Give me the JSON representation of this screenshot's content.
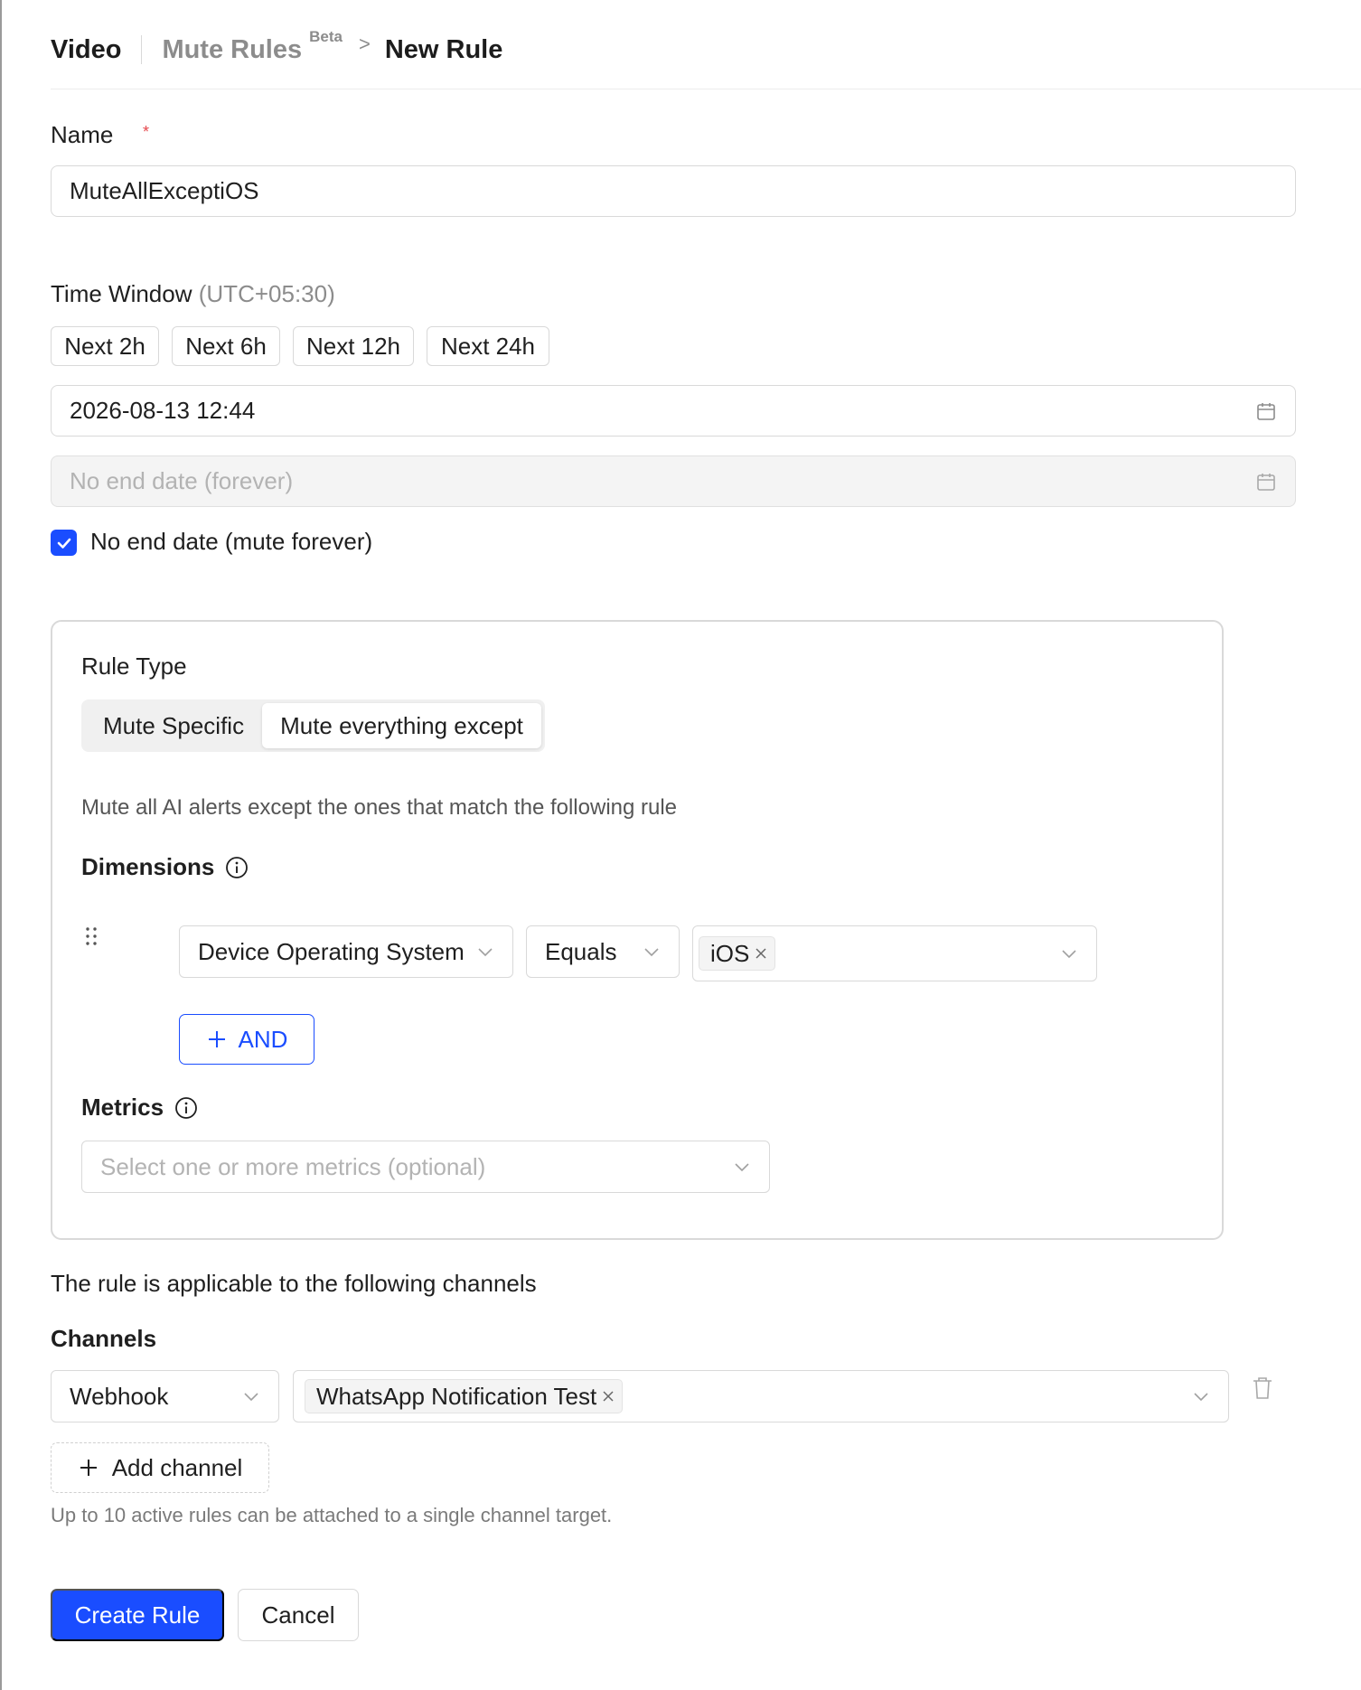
{
  "header": {
    "app": "Video",
    "breadcrumb": "Mute Rules",
    "badge": "Beta",
    "separator": ">",
    "current": "New Rule"
  },
  "name_field": {
    "label": "Name",
    "required_mark": "*",
    "value": "MuteAllExceptiOS"
  },
  "time_window": {
    "label": "Time Window",
    "timezone": "(UTC+05:30)",
    "quick_ranges": [
      "Next 2h",
      "Next 6h",
      "Next 12h",
      "Next 24h"
    ],
    "start": "2026-08-13 12:44",
    "end_placeholder": "No end date (forever)",
    "no_end_checkbox_label": "No end date (mute forever)",
    "no_end_checked": true
  },
  "rule": {
    "type_label": "Rule Type",
    "options": [
      "Mute Specific",
      "Mute everything except"
    ],
    "selected": "Mute everything except",
    "description": "Mute all AI alerts except the ones that match the following rule",
    "dimensions_label": "Dimensions",
    "dimension": {
      "field": "Device Operating System",
      "operator": "Equals",
      "values": [
        "iOS"
      ]
    },
    "and_button": "AND",
    "metrics_label": "Metrics",
    "metrics_placeholder": "Select one or more metrics (optional)"
  },
  "channels": {
    "intro": "The rule is applicable to the following channels",
    "label": "Channels",
    "type": "Webhook",
    "targets": [
      "WhatsApp Notification Test"
    ],
    "add_label": "Add channel",
    "note": "Up to 10 active rules can be attached to a single channel target."
  },
  "actions": {
    "create": "Create Rule",
    "cancel": "Cancel"
  },
  "colors": {
    "primary": "#1a4dff",
    "required": "#e5484d"
  }
}
